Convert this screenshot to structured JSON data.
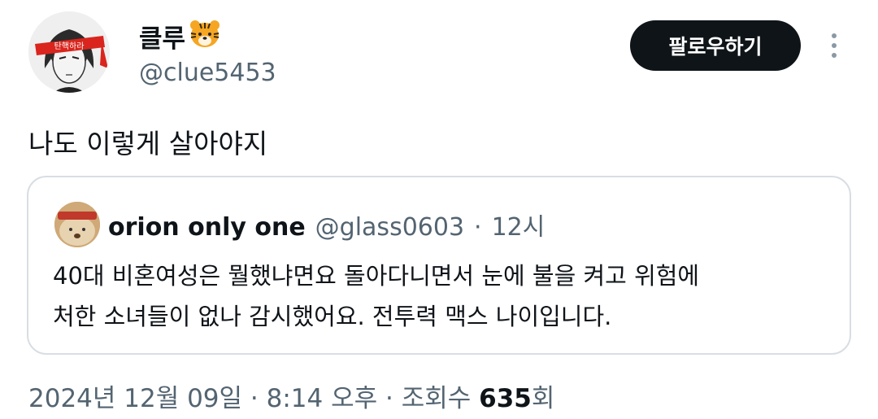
{
  "author": {
    "display_name": "클루",
    "handle": "@clue5453",
    "headband_text": "탄핵하라",
    "emoji_icon": "tiger-face-icon"
  },
  "follow_button": {
    "label": "팔로우하기"
  },
  "tweet": {
    "text": "나도 이렇게 살아야지"
  },
  "quoted_tweet": {
    "display_name": "orion only one",
    "handle": "@glass0603",
    "separator": "·",
    "time": "12시",
    "body_lines": [
      "40대 비혼여성은 뭘했냐면요 돌아다니면서 눈에 불을 켜고 위험에",
      "처한 소녀들이 없나 감시했어요. 전투력 맥스 나이입니다."
    ]
  },
  "meta": {
    "date": "2024년 12월 09일",
    "sep1": "·",
    "time": "8:14 오후",
    "sep2": "·",
    "views_label": "조회수",
    "views_count": "635",
    "views_suffix": "회"
  },
  "colors": {
    "text_primary": "#0f1419",
    "text_secondary": "#536471",
    "follow_bg": "#0f1419",
    "border": "#d8dee3",
    "headband": "#d9251d"
  }
}
